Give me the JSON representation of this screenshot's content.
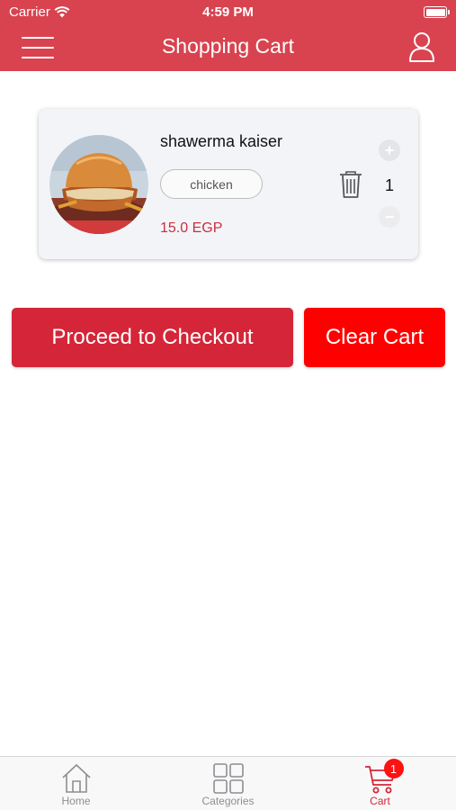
{
  "status_bar": {
    "carrier": "Carrier",
    "time": "4:59 PM"
  },
  "header": {
    "title": "Shopping Cart",
    "background_color": "#d8434f"
  },
  "cart": {
    "items": [
      {
        "name": "shawerma kaiser",
        "option": "chicken",
        "price": "15.0 EGP",
        "quantity": "1"
      }
    ]
  },
  "actions": {
    "checkout_label": "Proceed to Checkout",
    "checkout_color": "#d42638",
    "clear_label": "Clear Cart",
    "clear_color": "#ff0000"
  },
  "tab_bar": {
    "tabs": [
      {
        "label": "Home",
        "icon": "home-icon",
        "active": false
      },
      {
        "label": "Categories",
        "icon": "grid-icon",
        "active": false
      },
      {
        "label": "Cart",
        "icon": "cart-icon",
        "active": true,
        "badge": "1"
      }
    ]
  }
}
